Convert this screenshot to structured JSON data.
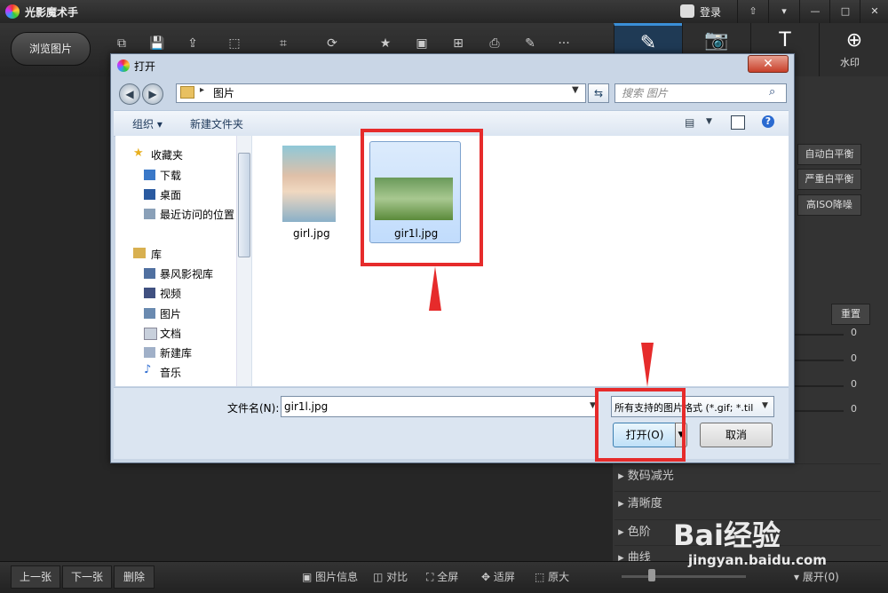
{
  "app": {
    "title": "光影魔术手",
    "login": "登录",
    "window_controls": [
      "⇧",
      "▾",
      "—",
      "□",
      "✕"
    ]
  },
  "toolbar": {
    "browse": "浏览图片",
    "tool_icons": [
      "rotate-icon",
      "save-icon",
      "export-icon",
      "crop-icon",
      "crop-tool-icon",
      "rotate-arrow-icon",
      "star-icon",
      "frame-icon",
      "grid-icon",
      "print-icon",
      "brush-icon",
      "more-icon"
    ],
    "tool_glyphs": [
      "⧉",
      "💾",
      "⇪",
      "⬚",
      "⌗",
      "⟳",
      "★",
      "▣",
      "⊞",
      "⎙",
      "✎",
      "···"
    ],
    "right_tabs": [
      "✎",
      "📷",
      "T",
      "⊕"
    ],
    "watermark_label": "水印"
  },
  "right_panel": {
    "buttons": [
      "自动白平衡",
      "严重白平衡",
      "高ISO降噪"
    ],
    "reset": "重置",
    "slider_values": [
      "0",
      "0",
      "0",
      "0"
    ],
    "sections": [
      "数码减光",
      "清晰度",
      "色阶",
      "曲线"
    ]
  },
  "bottom_bar": {
    "prev": "上一张",
    "next": "下一张",
    "delete": "删除",
    "items": [
      "图片信息",
      "对比",
      "全屏",
      "适屏",
      "原大"
    ],
    "expand": "展开(0)"
  },
  "dialog": {
    "title": "打开",
    "close": "✕",
    "address": "图片",
    "search_placeholder": "搜索 图片",
    "organize": "组织 ▾",
    "new_folder": "新建文件夹",
    "nav": {
      "favorites": "收藏夹",
      "fav_items": [
        "下载",
        "桌面",
        "最近访问的位置"
      ],
      "libraries": "库",
      "lib_items": [
        "暴风影视库",
        "视频",
        "图片",
        "文档",
        "新建库",
        "音乐"
      ]
    },
    "files": [
      {
        "name": "girl.jpg"
      },
      {
        "name": "gir1l.jpg",
        "selected": true
      }
    ],
    "filename_label": "文件名(N):",
    "filename_value": "gir1l.jpg",
    "filter": "所有支持的图片格式 (*.gif; *.til",
    "open": "打开(O)",
    "cancel": "取消"
  },
  "watermark": {
    "brand": "Bai经验",
    "url": "jingyan.baidu.com"
  }
}
